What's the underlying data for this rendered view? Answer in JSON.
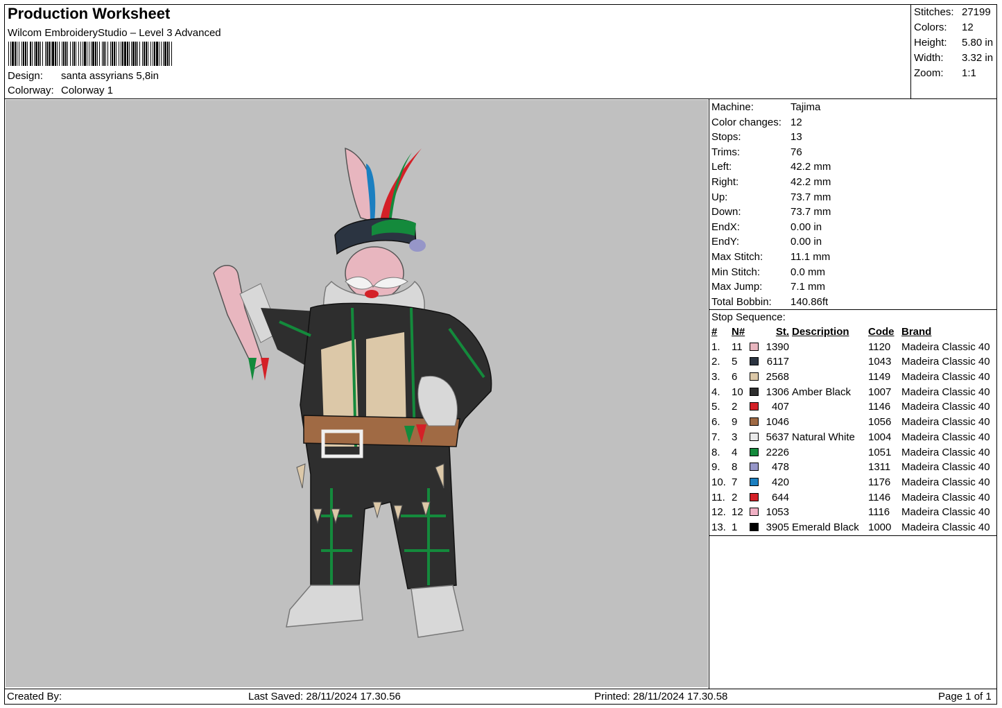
{
  "header": {
    "title": "Production Worksheet",
    "subtitle": "Wilcom EmbroideryStudio – Level 3 Advanced",
    "design_label": "Design:",
    "design_value": "santa assyrians 5,8in",
    "colorway_label": "Colorway:",
    "colorway_value": "Colorway 1"
  },
  "stats": [
    {
      "label": "Stitches:",
      "value": "27199"
    },
    {
      "label": "Colors:",
      "value": "12"
    },
    {
      "label": "Height:",
      "value": "5.80 in"
    },
    {
      "label": "Width:",
      "value": "3.32 in"
    },
    {
      "label": "Zoom:",
      "value": "1:1"
    }
  ],
  "machine_info": [
    {
      "label": "Machine:",
      "value": "Tajima"
    },
    {
      "label": "Color changes:",
      "value": "12"
    },
    {
      "label": "Stops:",
      "value": "13"
    },
    {
      "label": "Trims:",
      "value": "76"
    },
    {
      "label": "Left:",
      "value": "42.2 mm"
    },
    {
      "label": "Right:",
      "value": "42.2 mm"
    },
    {
      "label": "Up:",
      "value": "73.7 mm"
    },
    {
      "label": "Down:",
      "value": "73.7 mm"
    },
    {
      "label": "EndX:",
      "value": "0.00 in"
    },
    {
      "label": "EndY:",
      "value": "0.00 in"
    },
    {
      "label": "Max Stitch:",
      "value": "11.1 mm"
    },
    {
      "label": "Min Stitch:",
      "value": "0.0 mm"
    },
    {
      "label": "Max Jump:",
      "value": "7.1 mm"
    },
    {
      "label": "Total Bobbin:",
      "value": "140.86ft"
    }
  ],
  "stop_sequence": {
    "title": "Stop Sequence:",
    "headers": {
      "idx": "#",
      "n": "N#",
      "st": "St.",
      "desc": "Description",
      "code": "Code",
      "brand": "Brand"
    },
    "rows": [
      {
        "idx": "1.",
        "n": "11",
        "color": "#e8b6bf",
        "st": "1390",
        "desc": "",
        "code": "1120",
        "brand": "Madeira Classic 40"
      },
      {
        "idx": "2.",
        "n": "5",
        "color": "#2b3441",
        "st": "6117",
        "desc": "",
        "code": "1043",
        "brand": "Madeira Classic 40"
      },
      {
        "idx": "3.",
        "n": "6",
        "color": "#dcc8a8",
        "st": "2568",
        "desc": "",
        "code": "1149",
        "brand": "Madeira Classic 40"
      },
      {
        "idx": "4.",
        "n": "10",
        "color": "#2e2e2e",
        "st": "1306",
        "desc": "Amber Black",
        "code": "1007",
        "brand": "Madeira Classic 40"
      },
      {
        "idx": "5.",
        "n": "2",
        "color": "#d42027",
        "st": "407",
        "desc": "",
        "code": "1146",
        "brand": "Madeira Classic 40"
      },
      {
        "idx": "6.",
        "n": "9",
        "color": "#a06a44",
        "st": "1046",
        "desc": "",
        "code": "1056",
        "brand": "Madeira Classic 40"
      },
      {
        "idx": "7.",
        "n": "3",
        "color": "#eaeaea",
        "st": "5637",
        "desc": "Natural White",
        "code": "1004",
        "brand": "Madeira Classic 40"
      },
      {
        "idx": "8.",
        "n": "4",
        "color": "#148a3c",
        "st": "2226",
        "desc": "",
        "code": "1051",
        "brand": "Madeira Classic 40"
      },
      {
        "idx": "9.",
        "n": "8",
        "color": "#9696c8",
        "st": "478",
        "desc": "",
        "code": "1311",
        "brand": "Madeira Classic 40"
      },
      {
        "idx": "10.",
        "n": "7",
        "color": "#1b7fc0",
        "st": "420",
        "desc": "",
        "code": "1176",
        "brand": "Madeira Classic 40"
      },
      {
        "idx": "11.",
        "n": "2",
        "color": "#d42027",
        "st": "644",
        "desc": "",
        "code": "1146",
        "brand": "Madeira Classic 40"
      },
      {
        "idx": "12.",
        "n": "12",
        "color": "#f0b0c4",
        "st": "1053",
        "desc": "",
        "code": "1116",
        "brand": "Madeira Classic 40"
      },
      {
        "idx": "13.",
        "n": "1",
        "color": "#000000",
        "st": "3905",
        "desc": "Emerald Black",
        "code": "1000",
        "brand": "Madeira Classic 40"
      }
    ]
  },
  "footer": {
    "created_by": "Created By:",
    "last_saved": "Last Saved: 28/11/2024 17.30.56",
    "printed": "Printed: 28/11/2024 17.30.58",
    "page": "Page 1 of 1"
  },
  "colors": {
    "preview_background": "#c0c0c0"
  }
}
